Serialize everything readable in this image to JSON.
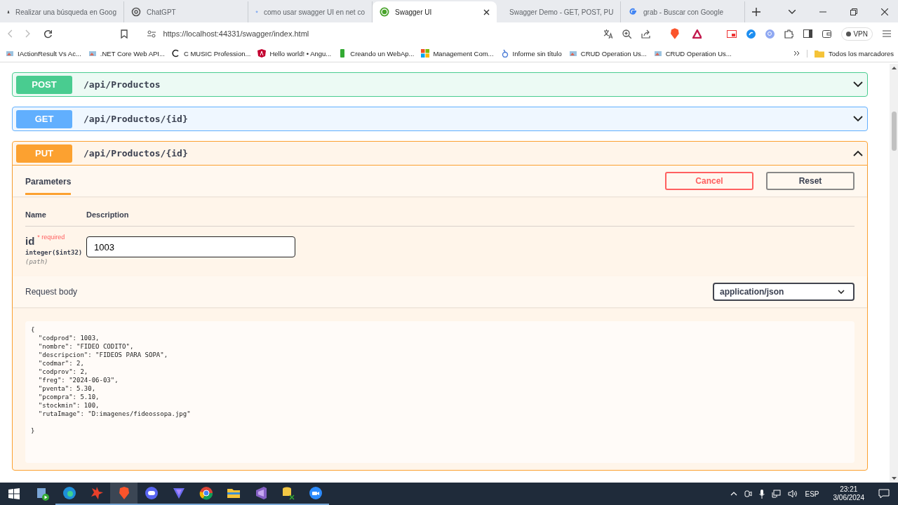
{
  "browser": {
    "tabs": [
      {
        "title": "Realizar una búsqueda en Goog",
        "selected": false
      },
      {
        "title": "ChatGPT",
        "selected": false
      },
      {
        "title": "como usar swagger UI en net co",
        "selected": false
      },
      {
        "title": "Swagger UI",
        "selected": true
      },
      {
        "title": "Swagger Demo - GET, POST, PU",
        "selected": false
      },
      {
        "title": "grab - Buscar con Google",
        "selected": false
      }
    ],
    "address": "https://localhost:44331/swagger/index.html",
    "vpn_label": "VPN",
    "bookmarks": [
      "IActionResult Vs Ac...",
      ".NET Core Web API...",
      "C MUSIC Profession...",
      "Hello world! • Angu...",
      "Creando un WebAp...",
      "Management Com...",
      "Informe sin título",
      "CRUD Operation Us...",
      "CRUD Operation Us..."
    ],
    "all_bookmarks": "Todos los marcadores"
  },
  "operations": [
    {
      "method": "POST",
      "path": "/api/Productos",
      "color": "#49cc90",
      "expanded": false
    },
    {
      "method": "GET",
      "path": "/api/Productos/{id}",
      "color": "#61affe",
      "expanded": false
    },
    {
      "method": "PUT",
      "path": "/api/Productos/{id}",
      "color": "#fca130",
      "expanded": true,
      "detail": {
        "tabs": [
          {
            "label": "Parameters",
            "selected": true
          }
        ],
        "buttons": [
          {
            "label": "Cancel",
            "kind": "cancel"
          },
          {
            "label": "Reset",
            "kind": "reset"
          }
        ],
        "columns": [
          "Name",
          "Description"
        ],
        "parameters": [
          {
            "name": "id",
            "required_mark": "* required",
            "type": "integer($int32)",
            "location": "(path)",
            "value": "1003"
          }
        ],
        "request_body": {
          "label": "Request body",
          "content_type": "application/json",
          "code": "{\n  \"codprod\": 1003,\n  \"nombre\": \"FIDEO CODITO\",\n  \"descripcion\": \"FIDEOS PARA SOPA\",\n  \"codmar\": 2,\n  \"codprov\": 2,\n  \"freg\": \"2024-06-03\",\n  \"pventa\": 5.30,\n  \"pcompra\": 5.10,\n  \"stockmin\": 100,\n  \"rutaImage\": \"D:imagenes/fideossopa.jpg\"\n\n}"
        }
      }
    }
  ],
  "taskbar": {
    "language": "ESP",
    "time": "23:21",
    "date": "3/06/2024"
  }
}
